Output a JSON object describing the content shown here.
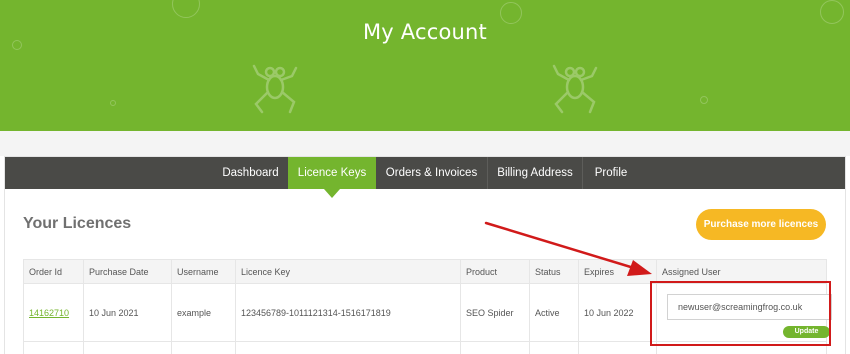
{
  "header": {
    "title": "My Account"
  },
  "nav": {
    "tabs": [
      {
        "label": "Dashboard"
      },
      {
        "label": "Licence Keys"
      },
      {
        "label": "Orders & Invoices"
      },
      {
        "label": "Billing Address"
      },
      {
        "label": "Profile"
      }
    ],
    "active_tab": "Licence Keys"
  },
  "licences": {
    "title": "Your Licences",
    "purchase_button": "Purchase more licences",
    "columns": [
      "Order Id",
      "Purchase Date",
      "Username",
      "Licence Key",
      "Product",
      "Status",
      "Expires",
      "Assigned User"
    ],
    "rows": [
      {
        "order_id": "14162710",
        "purchase_date": "10 Jun 2021",
        "username": "example",
        "licence_key": "123456789-1011121314-1516171819",
        "product": "SEO Spider",
        "status": "Active",
        "expires": "10 Jun 2022",
        "assigned_user": "newuser@screamingfrog.co.uk",
        "update_label": "Update"
      }
    ]
  },
  "colors": {
    "brand_green": "#74b52e",
    "nav_dark": "#4a4a47",
    "accent_orange": "#f6b824",
    "annotation_red": "#d11a1a"
  }
}
